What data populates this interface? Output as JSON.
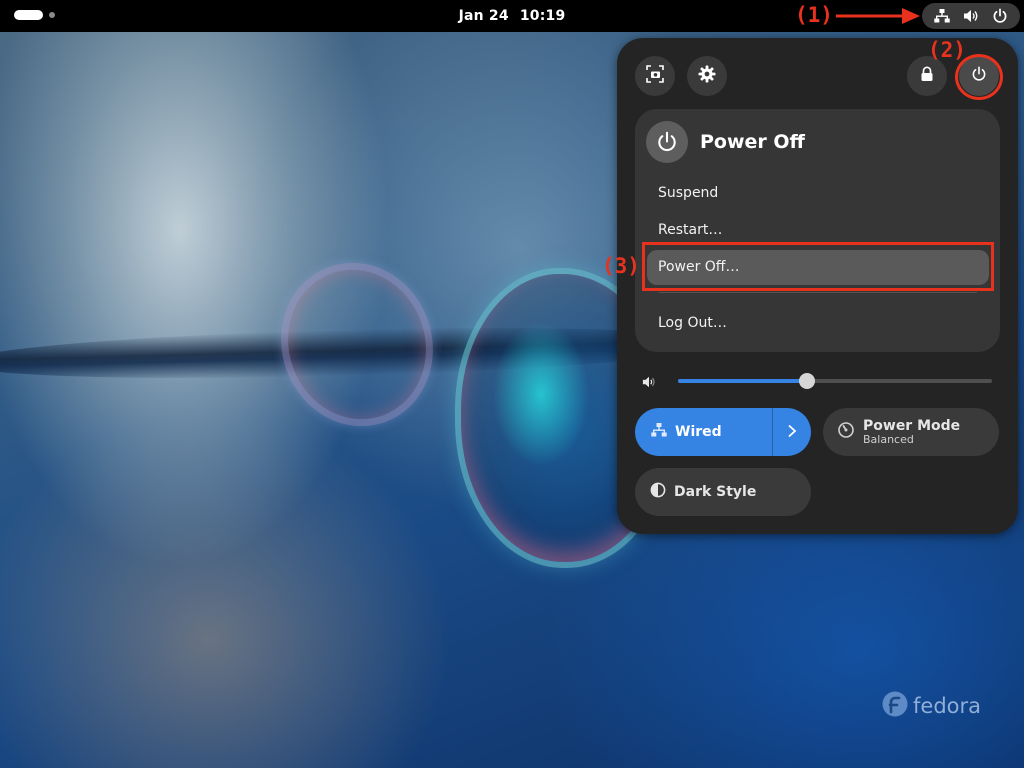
{
  "topbar": {
    "date": "Jan 24",
    "time": "10:19",
    "status_icons": [
      "network-wired-icon",
      "volume-icon",
      "power-icon"
    ]
  },
  "annotations": {
    "label_1": "(1)",
    "label_2": "(2)",
    "label_3": "(3)",
    "color": "#e8321e"
  },
  "quick_settings": {
    "top_buttons": [
      "screenshot-icon",
      "settings-icon",
      "lock-icon",
      "power-icon"
    ],
    "power_menu": {
      "title": "Power Off",
      "items": [
        {
          "label": "Suspend",
          "highlighted": false
        },
        {
          "label": "Restart…",
          "highlighted": false
        },
        {
          "label": "Power Off…",
          "highlighted": true
        },
        {
          "label": "Log Out…",
          "highlighted": false
        }
      ]
    },
    "volume": {
      "level": 0.41
    },
    "tiles": {
      "wired": {
        "label": "Wired",
        "active": true
      },
      "power_mode": {
        "label": "Power Mode",
        "sub": "Balanced"
      },
      "dark_style": {
        "label": "Dark Style"
      }
    },
    "accent_color": "#3584e4"
  },
  "wallpaper": {
    "brand": "fedora"
  }
}
